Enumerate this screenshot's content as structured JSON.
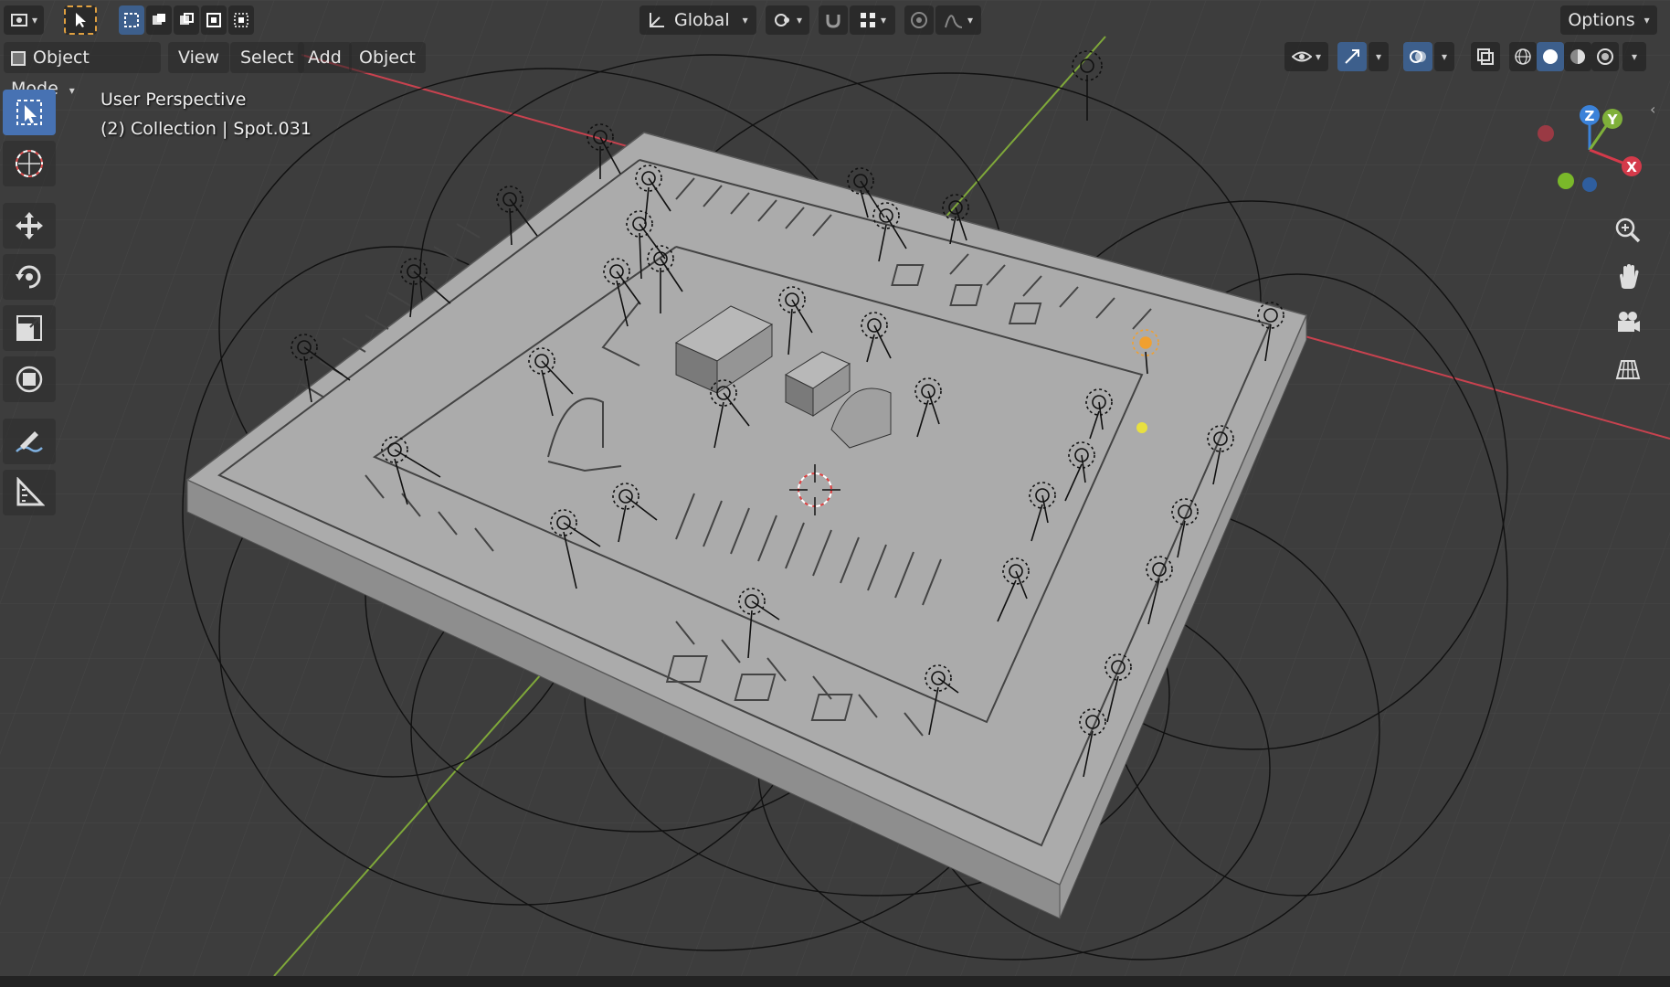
{
  "header": {
    "transform_orientation": "Global",
    "options_label": "Options"
  },
  "menu": {
    "mode": "Object Mode",
    "view": "View",
    "select": "Select",
    "add": "Add",
    "object": "Object"
  },
  "viewport_info": {
    "perspective": "User Perspective",
    "collection": "(2) Collection | Spot.031"
  },
  "gizmo": {
    "z": "Z",
    "y": "Y",
    "x": "X"
  },
  "tools": [
    "select-box-icon",
    "cursor-icon",
    "move-icon",
    "rotate-icon",
    "scale-icon",
    "transform-icon",
    "annotate-icon",
    "measure-icon"
  ],
  "nav_icons": [
    "zoom-icon",
    "pan-hand-icon",
    "camera-icon",
    "ortho-grid-icon"
  ],
  "colors": {
    "active_tool": "#4772b3",
    "x_axis": "#d43a4a",
    "y_axis": "#7fb03a",
    "z_axis": "#3b82d9",
    "viewport_bg": "#3d3d3d",
    "mesh": "#a9a9a9",
    "selected_light": "#f0a030"
  }
}
